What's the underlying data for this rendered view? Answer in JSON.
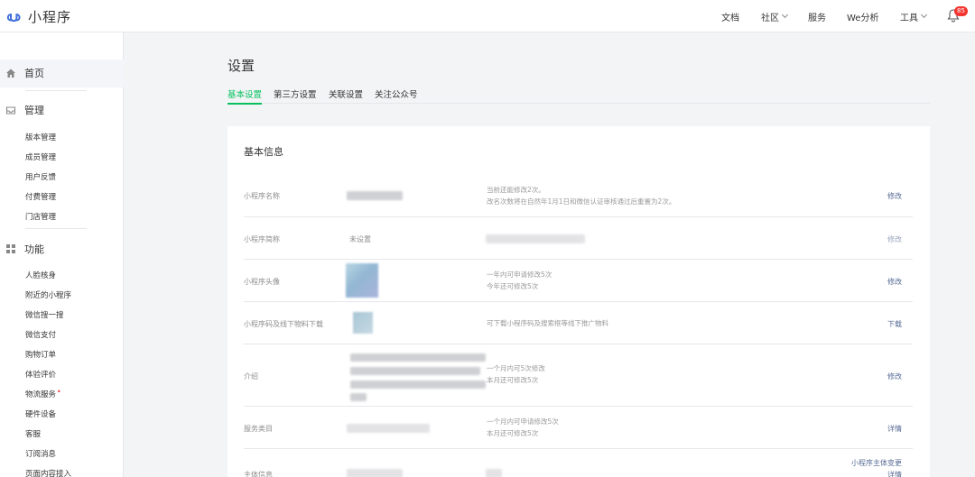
{
  "app": {
    "name": "小程序"
  },
  "topnav": {
    "docs": "文档",
    "community": "社区",
    "services": "服务",
    "analytics": "We分析",
    "tools": "工具",
    "notification_count": "85"
  },
  "sidebar": {
    "home": "首页",
    "manage": {
      "label": "管理",
      "items": [
        "版本管理",
        "成员管理",
        "用户反馈",
        "付费管理",
        "门店管理"
      ]
    },
    "features": {
      "label": "功能",
      "items": [
        "人脸核身",
        "附近的小程序",
        "微信搜一搜",
        "微信支付",
        "购物订单",
        "体验评价",
        "物流服务",
        "硬件设备",
        "客服",
        "订阅消息",
        "页面内容接入"
      ],
      "dot": "•"
    }
  },
  "page": {
    "title": "设置",
    "tabs": [
      "基本设置",
      "第三方设置",
      "关联设置",
      "关注公众号"
    ]
  },
  "basic_info": {
    "title": "基本信息",
    "rows": [
      {
        "label": "小程序名称",
        "desc1": "当前还能修改2次。",
        "desc2": "改名次数将在自然年1月1日和微信认证审核通过后重置为2次。",
        "action": "修改"
      },
      {
        "label": "小程序简称",
        "value": "未设置",
        "action": "修改"
      },
      {
        "label": "小程序头像",
        "desc1": "一年内可申请修改5次",
        "desc2": "今年还可修改5次",
        "action": "修改"
      },
      {
        "label": "小程序码及线下物料下载",
        "desc1": "可下载小程序码及搜索框等线下推广物料",
        "action": "下载"
      },
      {
        "label": "介绍",
        "desc1": "一个月内可5次修改",
        "desc2": "本月还可修改5次",
        "action": "修改"
      },
      {
        "label": "服务类目",
        "desc1": "一个月内可申请修改5次",
        "desc2": "本月还可修改5次",
        "action": "详情"
      },
      {
        "label": "主体信息",
        "action1": "小程序主体变更",
        "action2": "详情"
      }
    ]
  }
}
